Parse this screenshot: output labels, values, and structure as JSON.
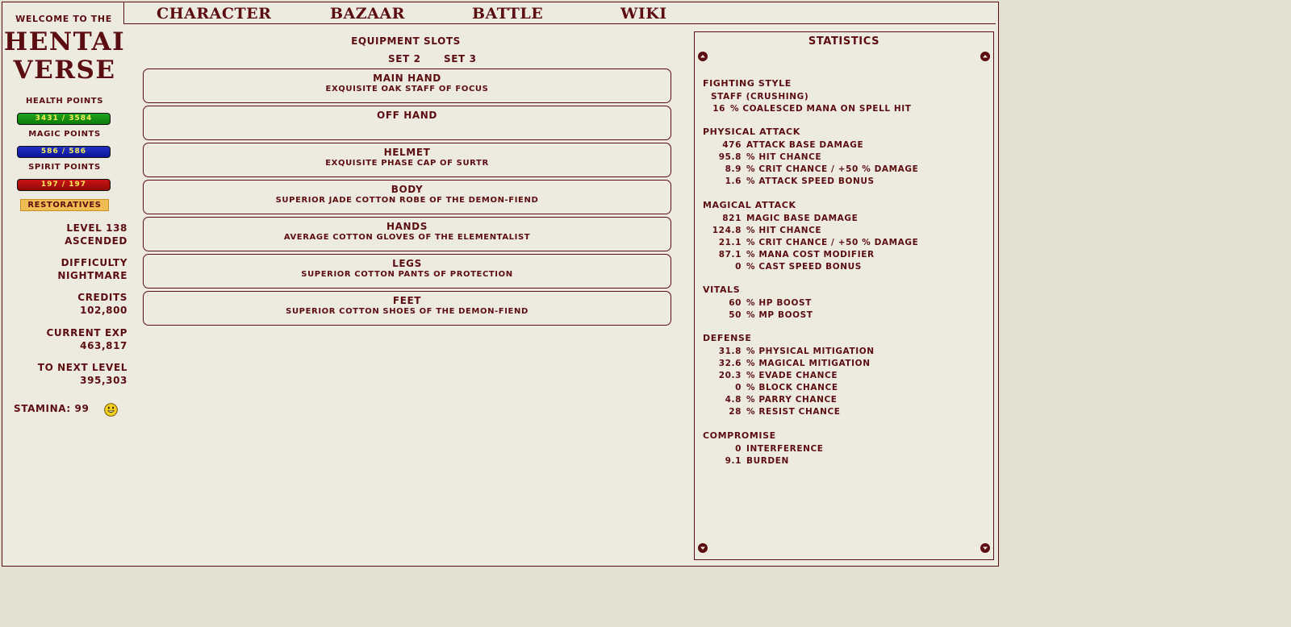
{
  "sidebar": {
    "welcome": "Welcome to the",
    "logo_line1": "HENTAI",
    "logo_line2": "VERSE",
    "health_label": "Health points",
    "health_value": "3431 / 3584",
    "health_fraction": 0.957,
    "magic_label": "Magic points",
    "magic_value": "586 / 586",
    "magic_fraction": 1.0,
    "spirit_label": "Spirit points",
    "spirit_value": "197 / 197",
    "spirit_fraction": 1.0,
    "restoratives_label": "Restoratives",
    "level": "Level 138",
    "rank": "Ascended",
    "difficulty_label": "Difficulty",
    "difficulty_value": "Nightmare",
    "credits_label": "Credits",
    "credits_value": "102,800",
    "exp_label": "Current Exp",
    "exp_value": "463,817",
    "next_label": "To Next Level",
    "next_value": "395,303",
    "stamina": "Stamina: 99",
    "stamina_icon": "happy-smiley-icon"
  },
  "nav": {
    "character": "Character",
    "bazaar": "Bazaar",
    "battle": "Battle",
    "wiki": "Wiki"
  },
  "equipment": {
    "title": "Equipment Slots",
    "set2": "Set 2",
    "set3": "Set 3",
    "slots": [
      {
        "name": "Main Hand",
        "item": "Exquisite Oak Staff of Focus"
      },
      {
        "name": "Off Hand",
        "item": ""
      },
      {
        "name": "Helmet",
        "item": "Exquisite Phase Cap of Surtr"
      },
      {
        "name": "Body",
        "item": "Superior Jade Cotton Robe of the Demon-fiend"
      },
      {
        "name": "Hands",
        "item": "Average Cotton Gloves of the Elementalist"
      },
      {
        "name": "Legs",
        "item": "Superior Cotton Pants of Protection"
      },
      {
        "name": "Feet",
        "item": "Superior Cotton Shoes of the Demon-fiend"
      }
    ]
  },
  "statistics": {
    "title": "Statistics",
    "fighting_style": {
      "header": "Fighting Style",
      "style": "Staff (Crushing)",
      "bonus_value": "16",
      "bonus_text": "% Coalesced Mana on Spell Hit"
    },
    "physical_attack": {
      "header": "Physical Attack",
      "rows": [
        {
          "v": "476",
          "t": "Attack Base Damage"
        },
        {
          "v": "95.8",
          "t": "% Hit Chance"
        },
        {
          "v": "8.9",
          "t": "% Crit Chance / +50 % Damage"
        },
        {
          "v": "1.6",
          "t": "% Attack Speed Bonus"
        }
      ]
    },
    "magical_attack": {
      "header": "Magical Attack",
      "rows": [
        {
          "v": "821",
          "t": "Magic Base Damage"
        },
        {
          "v": "124.8",
          "t": "% Hit Chance"
        },
        {
          "v": "21.1",
          "t": "% Crit Chance / +50 % Damage"
        },
        {
          "v": "87.1",
          "t": "% Mana Cost Modifier"
        },
        {
          "v": "0",
          "t": "% Cast Speed Bonus"
        }
      ]
    },
    "vitals": {
      "header": "Vitals",
      "rows": [
        {
          "v": "60",
          "t": "% HP Boost"
        },
        {
          "v": "50",
          "t": "% MP Boost"
        }
      ]
    },
    "defense": {
      "header": "Defense",
      "rows": [
        {
          "v": "31.8",
          "t": "% Physical Mitigation"
        },
        {
          "v": "32.6",
          "t": "% Magical Mitigation"
        },
        {
          "v": "20.3",
          "t": "% Evade Chance"
        },
        {
          "v": "0",
          "t": "% Block Chance"
        },
        {
          "v": "4.8",
          "t": "% Parry Chance"
        },
        {
          "v": "28",
          "t": "% Resist Chance"
        }
      ]
    },
    "compromise": {
      "header": "Compromise",
      "rows": [
        {
          "v": "0",
          "t": "Interference"
        },
        {
          "v": "9.1",
          "t": "Burden"
        }
      ]
    },
    "scroll_icons": [
      "scroll-up-icon",
      "scroll-down-icon"
    ]
  },
  "colors": {
    "text": "#5c0d11",
    "panel": "#edebdf",
    "page": "#e3e0d1",
    "hp_bar": "#1ea21e",
    "mp_bar": "#2230c2",
    "sp_bar": "#c81414",
    "bar_text": "#f6ef58"
  }
}
